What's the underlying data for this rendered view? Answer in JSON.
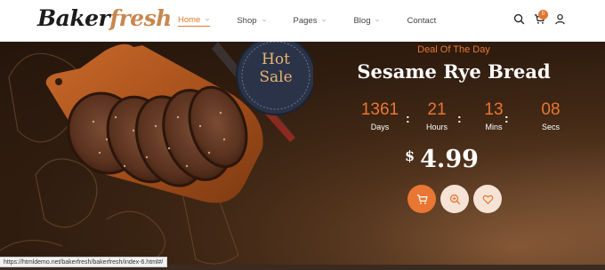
{
  "brand": {
    "name_part1": "Baker",
    "name_part2": "fresh"
  },
  "nav": {
    "items": [
      {
        "label": "Home",
        "active": true,
        "dropdown": true
      },
      {
        "label": "Shop",
        "active": false,
        "dropdown": true
      },
      {
        "label": "Pages",
        "active": false,
        "dropdown": true
      },
      {
        "label": "Blog",
        "active": false,
        "dropdown": true
      },
      {
        "label": "Contact",
        "active": false,
        "dropdown": false
      }
    ]
  },
  "header_tools": {
    "search_icon": "search-icon",
    "cart_icon": "cart-icon",
    "cart_count": "0",
    "account_icon": "user-icon"
  },
  "hero": {
    "badge_line1": "Hot",
    "badge_line2": "Sale",
    "deal_label": "Deal Of The Day",
    "product_name": "Sesame Rye Bread",
    "countdown": [
      {
        "value": "1361",
        "label": "Days"
      },
      {
        "value": "21",
        "label": "Hours"
      },
      {
        "value": "13",
        "label": "Mins"
      },
      {
        "value": "08",
        "label": "Secs"
      }
    ],
    "separator": ":",
    "price_currency": "$",
    "price_amount": "4.99",
    "actions": [
      {
        "icon": "cart-icon"
      },
      {
        "icon": "zoom-in-icon"
      },
      {
        "icon": "heart-icon"
      }
    ]
  },
  "status_bar": {
    "url": "https://htmldemo.net/bakerfresh/bakerfresh/index-6.html#/"
  },
  "colors": {
    "accent": "#e97632",
    "brand_gold": "#c7874e",
    "hero_dark": "#2f1c0f"
  }
}
